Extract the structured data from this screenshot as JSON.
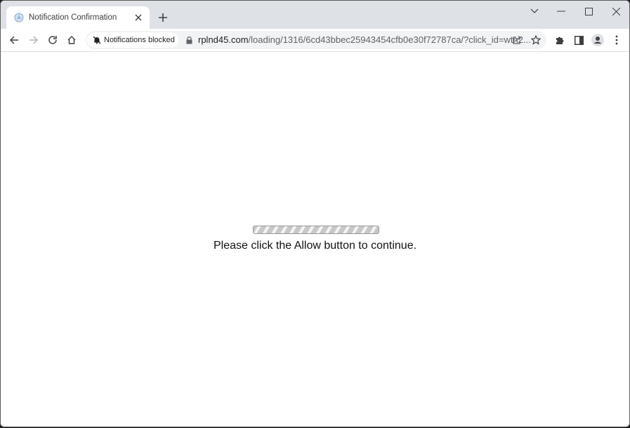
{
  "browser": {
    "tab": {
      "title": "Notification Confirmation",
      "favicon": "bell-globe-icon",
      "close_icon": "close-icon"
    },
    "new_tab_icon": "plus-icon",
    "window_controls": [
      "chevron-down-icon",
      "minimize-icon",
      "maximize-icon",
      "close-icon"
    ],
    "toolbar": {
      "back_icon": "arrow-left-icon",
      "forward_icon": "arrow-right-icon",
      "reload_icon": "reload-icon",
      "home_icon": "home-icon",
      "permission_chip": "Notifications blocked",
      "url_host": "rplnd45.com",
      "url_path": "/loading/1316/6cd43bbec25943454cfb0e30f72787ca/?click_id=wtn2...",
      "share_icon": "share-icon",
      "bookmark_icon": "star-icon",
      "extensions_icon": "puzzle-icon",
      "side_panel_icon": "side-panel-icon",
      "profile_icon": "profile-icon",
      "menu_icon": "kebab-menu-icon"
    }
  },
  "page": {
    "loading_bar": "indeterminate",
    "message": "Please click the Allow button to continue."
  }
}
